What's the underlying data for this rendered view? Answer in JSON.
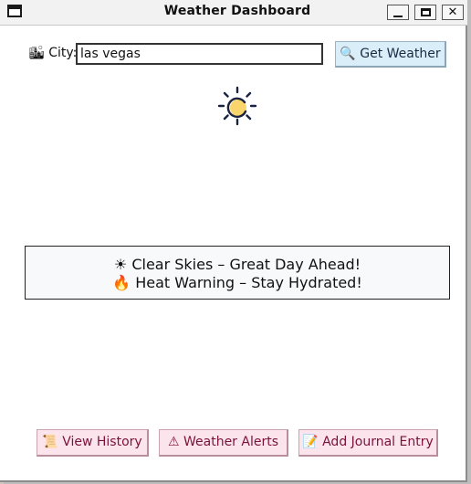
{
  "window": {
    "title": "Weather Dashboard",
    "controls": {
      "minimize": "_",
      "maximize": "□",
      "close": "✕"
    }
  },
  "search": {
    "label": "🏙 City:",
    "value": "las vegas",
    "button_label": "🔍 Get Weather"
  },
  "weather": {
    "icon": "sun-icon",
    "summary_line1": "☀ Clear Skies – Great Day Ahead!",
    "summary_line2": "🔥 Heat Warning – Stay Hydrated!"
  },
  "actions": {
    "history_label": "📜 View History",
    "alerts_label": "⚠ Weather Alerts",
    "journal_label": "📝 Add Journal Entry"
  },
  "colors": {
    "primary_button_bg": "#d9eef8",
    "secondary_button_bg": "#fce4ec",
    "secondary_button_text": "#7a1238",
    "sun_fill": "#f9d56b",
    "sun_stroke": "#1c2340"
  }
}
